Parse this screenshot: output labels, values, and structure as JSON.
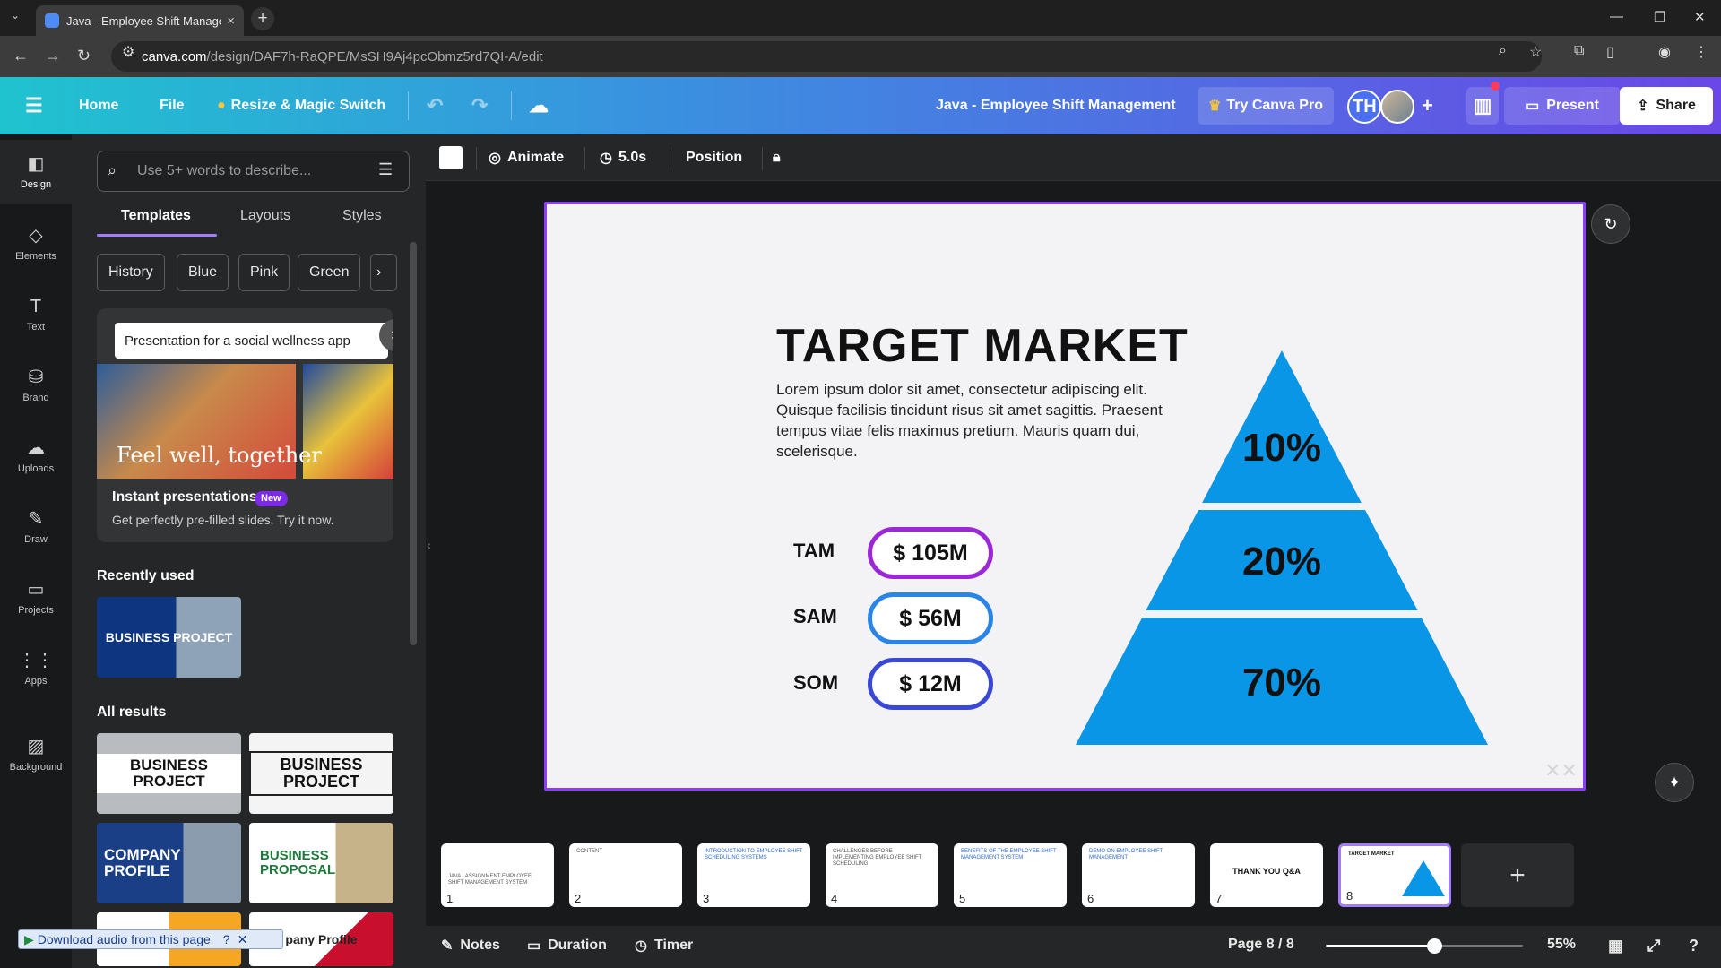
{
  "browser": {
    "tab_title": "Java - Employee Shift Managem",
    "url_host": "canva.com",
    "url_path": "/design/DAF7h-RaQPE/MsSH9Aj4pcObmz5rd7QI-A/edit"
  },
  "header": {
    "home": "Home",
    "file": "File",
    "resize": "Resize & Magic Switch",
    "doc_title": "Java - Employee Shift Management",
    "try_pro": "Try Canva Pro",
    "avatar_initials": "TH",
    "present": "Present",
    "share": "Share"
  },
  "rail": [
    {
      "label": "Design",
      "icon": "design-icon"
    },
    {
      "label": "Elements",
      "icon": "elements-icon"
    },
    {
      "label": "Text",
      "icon": "text-icon"
    },
    {
      "label": "Brand",
      "icon": "brand-icon"
    },
    {
      "label": "Uploads",
      "icon": "uploads-icon"
    },
    {
      "label": "Draw",
      "icon": "draw-icon"
    },
    {
      "label": "Projects",
      "icon": "projects-icon"
    },
    {
      "label": "Apps",
      "icon": "apps-icon"
    },
    {
      "label": "Background",
      "icon": "background-icon"
    }
  ],
  "panel": {
    "search_placeholder": "Use 5+ words to describe...",
    "tabs": [
      "Templates",
      "Layouts",
      "Styles"
    ],
    "chips": [
      "History",
      "Blue",
      "Pink",
      "Green"
    ],
    "promo": {
      "input_text": "Presentation for a social wellness app",
      "tagline": "Feel well, together",
      "title": "Instant presentations",
      "badge": "New",
      "desc": "Get perfectly pre-filled slides. Try it now."
    },
    "recently_used": "Recently used",
    "all_results": "All results",
    "recent_thumb": "BUSINESS PROJECT",
    "results": [
      "BUSINESS PROJECT",
      "BUSINESS PROJECT",
      "COMPANY PROFILE",
      "BUSINESS PROPOSAL",
      "",
      "pany Profile"
    ],
    "download_bar": "Download audio from this page"
  },
  "toolbar": {
    "animate": "Animate",
    "duration": "5.0s",
    "position": "Position"
  },
  "slide": {
    "title": "TARGET MARKET",
    "body": "Lorem ipsum dolor sit amet, consectetur adipiscing elit. Quisque facilisis tincidunt risus sit amet sagittis. Praesent tempus vitae felis maximus pretium. Mauris quam dui, scelerisque.",
    "markets": [
      {
        "label": "TAM",
        "value": "$ 105M",
        "color": "#9b27d6"
      },
      {
        "label": "SAM",
        "value": "$ 56M",
        "color": "#2a86e6"
      },
      {
        "label": "SOM",
        "value": "$ 12M",
        "color": "#3a48d6"
      }
    ],
    "pyramid": [
      {
        "label": "10%",
        "value": 10
      },
      {
        "label": "20%",
        "value": 20
      },
      {
        "label": "70%",
        "value": 70
      }
    ],
    "pyramid_color": "#0a96e6"
  },
  "pages": [
    {
      "num": "1",
      "mini": "JAVA - ASSIGNMENT EMPLOYEE SHIFT MANAGEMENT SYSTEM"
    },
    {
      "num": "2",
      "mini": "CONTENT"
    },
    {
      "num": "3",
      "mini": "INTRODUCTION TO EMPLOYEE SHIFT SCHEDULING SYSTEMS"
    },
    {
      "num": "4",
      "mini": "CHALLENGES BEFORE IMPLEMENTING EMPLOYEE SHIFT SCHEDULING"
    },
    {
      "num": "5",
      "mini": "BENEFITS OF THE EMPLOYEE SHIFT MANAGEMENT SYSTEM"
    },
    {
      "num": "6",
      "mini": "DEMO ON EMPLOYEE SHIFT MANAGEMENT"
    },
    {
      "num": "7",
      "mini": "THANK YOU Q&A"
    },
    {
      "num": "8",
      "mini": "TARGET MARKET"
    }
  ],
  "footer": {
    "notes": "Notes",
    "duration": "Duration",
    "timer": "Timer",
    "page": "Page 8 / 8",
    "zoom": "55%",
    "zoom_fraction": 0.55
  },
  "colors": {
    "accent": "#8b3dff",
    "header_gradient_start": "#1fc3cf",
    "header_gradient_end": "#6a47e6"
  }
}
